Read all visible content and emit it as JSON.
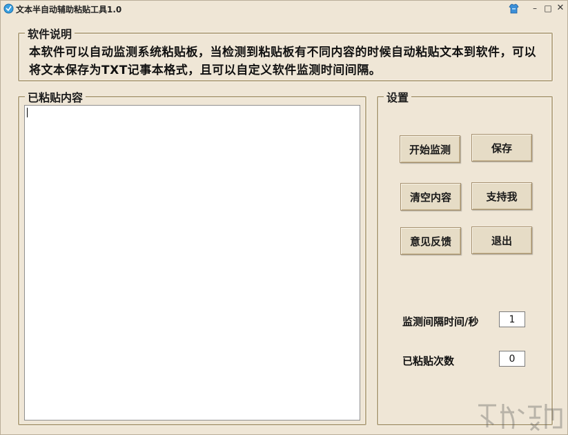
{
  "window": {
    "title": "文本半自动辅助粘贴工具1.0",
    "controls": {
      "minimize": "–",
      "maximize": "□",
      "close": "✕"
    }
  },
  "description": {
    "legend": "软件说明",
    "text": "本软件可以自动监测系统粘贴板，当检测到粘贴板有不同内容的时候自动粘贴文本到软件，可以将文本保存为TXT记事本格式，且可以自定义软件监测时间间隔。"
  },
  "content": {
    "legend": "已粘贴内容",
    "value": ""
  },
  "settings": {
    "legend": "设置",
    "buttons": {
      "start": "开始监测",
      "save": "保存",
      "clear": "清空内容",
      "support": "支持我",
      "feedback": "意见反馈",
      "exit": "退出"
    },
    "interval_label": "监测间隔时间/秒",
    "interval_value": "1",
    "count_label": "已粘贴次数",
    "count_value": "0"
  },
  "colors": {
    "background": "#efe6d6",
    "border": "#b8a988",
    "button": "#e6dcc6"
  },
  "icons": [
    "app-icon",
    "skin-icon",
    "minimize-icon",
    "maximize-icon",
    "close-icon"
  ]
}
